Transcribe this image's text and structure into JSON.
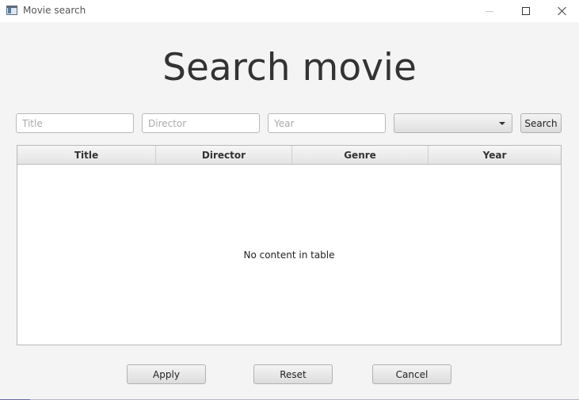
{
  "window": {
    "title": "Movie search"
  },
  "heading": "Search movie",
  "search": {
    "title_placeholder": "Title",
    "director_placeholder": "Director",
    "year_placeholder": "Year",
    "genre_selected": "",
    "search_label": "Search"
  },
  "table": {
    "columns": [
      "Title",
      "Director",
      "Genre",
      "Year"
    ],
    "rows": [],
    "empty_message": "No content in table"
  },
  "actions": {
    "apply_label": "Apply",
    "reset_label": "Reset",
    "cancel_label": "Cancel"
  },
  "icons": {
    "app": "app-window-icon",
    "minimize": "minimize-icon",
    "maximize": "maximize-icon",
    "close": "close-icon",
    "dropdown": "chevron-down-icon"
  }
}
